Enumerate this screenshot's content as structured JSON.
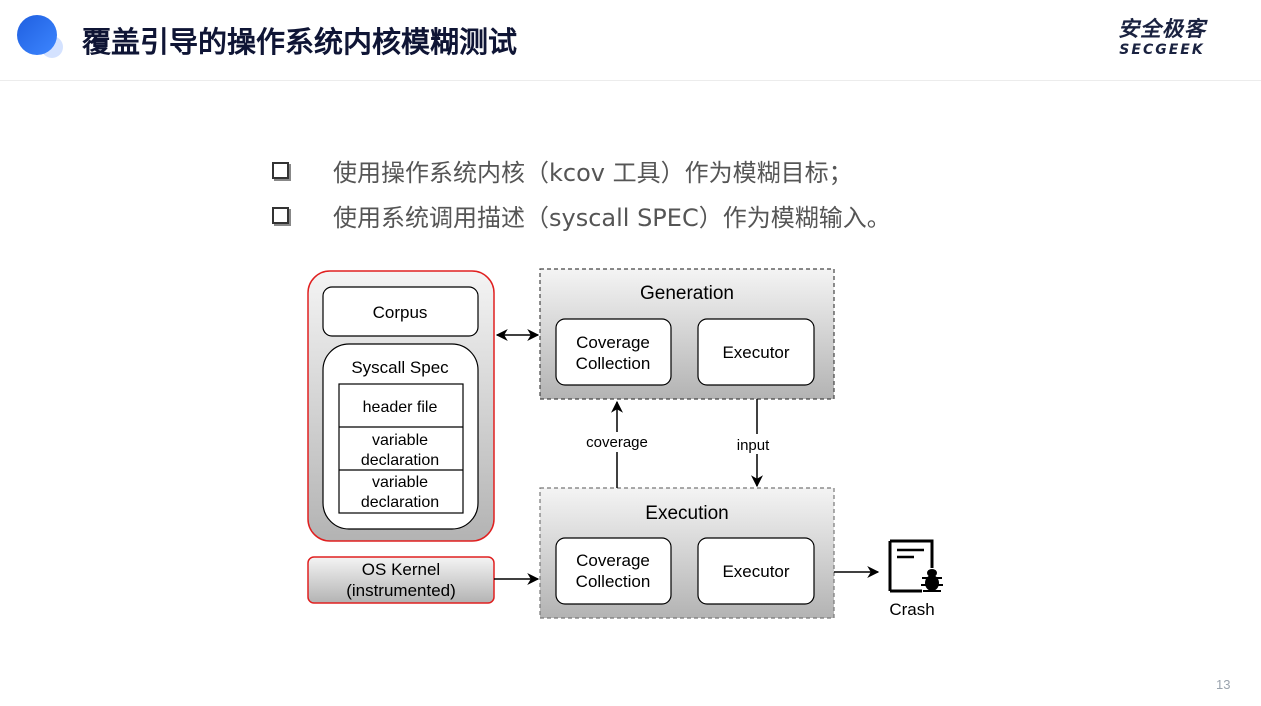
{
  "header": {
    "title": "覆盖引导的操作系统内核模糊测试",
    "logo_cn": "安全极客",
    "logo_en": "SECGEEK",
    "accent_color": "#2a6ef0"
  },
  "bullets": [
    {
      "icon": "checkbox-icon",
      "text": "使用操作系统内核（kcov 工具）作为模糊目标；"
    },
    {
      "icon": "checkbox-icon",
      "text": "使用系统调用描述（syscall SPEC）作为模糊输入。"
    }
  ],
  "diagram": {
    "left_group": {
      "corpus": "Corpus",
      "syscall_spec": {
        "title": "Syscall Spec",
        "rows": [
          "header file",
          "variable declaration",
          "variable declaration"
        ]
      },
      "border_color": "#e02020"
    },
    "os_kernel": {
      "line1": "OS Kernel",
      "line2": "(instrumented)"
    },
    "generation": {
      "title": "Generation",
      "coverage_line1": "Coverage",
      "coverage_line2": "Collection",
      "executor": "Executor"
    },
    "execution": {
      "title": "Execution",
      "coverage_line1": "Coverage",
      "coverage_line2": "Collection",
      "executor": "Executor"
    },
    "edges": {
      "coverage_label": "coverage",
      "input_label": "input"
    },
    "crash": {
      "icon": "crash-bug-icon",
      "label": "Crash"
    }
  },
  "footer": {
    "page_number": "13"
  }
}
